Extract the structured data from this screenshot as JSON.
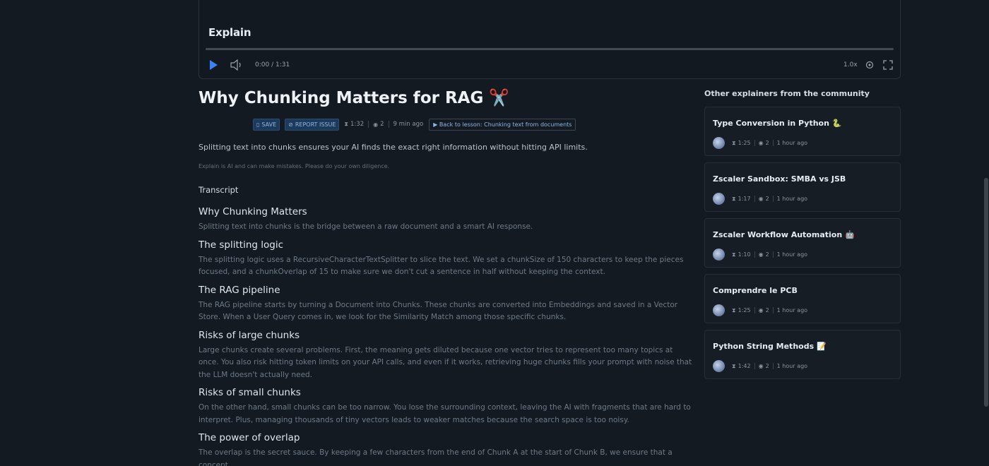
{
  "player": {
    "logo": "Explain",
    "time": "0:00 / 1:31",
    "speed": "1.0x",
    "progress": 0,
    "accent": "#3b82f6"
  },
  "main": {
    "title": "Why Chunking Matters for RAG ✂️",
    "actions": {
      "save": "SAVE",
      "report": "REPORT ISSUE"
    },
    "meta": {
      "duration": "1:32",
      "views": "2",
      "posted": "9 min ago"
    },
    "back_link": "▶ Back to lesson: Chunking text from documents",
    "summary": "Splitting text into chunks ensures your AI finds the exact right information without hitting API limits.",
    "disclaimer": "Explain is AI and can make mistakes. Please do your own diligence.",
    "transcript_label": "Transcript",
    "sections": [
      {
        "heading": "Why Chunking Matters",
        "body": "Splitting text into chunks is the bridge between a raw document and a smart AI response."
      },
      {
        "heading": "The splitting logic",
        "body": "The splitting logic uses a RecursiveCharacterTextSplitter to slice the text. We set a chunkSize of 150 characters to keep the pieces focused, and a chunkOverlap of 15 to make sure we don't cut a sentence in half without keeping the context."
      },
      {
        "heading": "The RAG pipeline",
        "body": "The RAG pipeline starts by turning a Document into Chunks. These chunks are converted into Embeddings and saved in a Vector Store. When a User Query comes in, we look for the Similarity Match among those specific chunks."
      },
      {
        "heading": "Risks of large chunks",
        "body": "Large chunks create several problems. First, the meaning gets diluted because one vector tries to represent too many topics at once. You also risk hitting token limits on your API calls, and even if it works, retrieving huge chunks fills your prompt with noise that the LLM doesn't actually need."
      },
      {
        "heading": "Risks of small chunks",
        "body": "On the other hand, small chunks can be too narrow. You lose the surrounding context, leaving the AI with fragments that are hard to interpret. Plus, managing thousands of tiny vectors leads to weaker matches because the search space is too noisy."
      },
      {
        "heading": "The power of overlap",
        "body": "The overlap is the secret sauce. By keeping a few characters from the end of Chunk A at the start of Chunk B, we ensure that a concept"
      }
    ]
  },
  "sidebar": {
    "title": "Other explainers from the community",
    "cards": [
      {
        "title": "Type Conversion in Python 🐍",
        "duration": "1:25",
        "views": "2",
        "posted": "1 hour ago"
      },
      {
        "title": "Zscaler Sandbox: SMBA vs JSB",
        "duration": "1:17",
        "views": "2",
        "posted": "1 hour ago"
      },
      {
        "title": "Zscaler Workflow Automation 🤖",
        "duration": "1:10",
        "views": "2",
        "posted": "1 hour ago"
      },
      {
        "title": "Comprendre le PCB",
        "duration": "1:25",
        "views": "2",
        "posted": "1 hour ago"
      },
      {
        "title": "Python String Methods 📝",
        "duration": "1:42",
        "views": "2",
        "posted": "1 hour ago"
      }
    ]
  }
}
